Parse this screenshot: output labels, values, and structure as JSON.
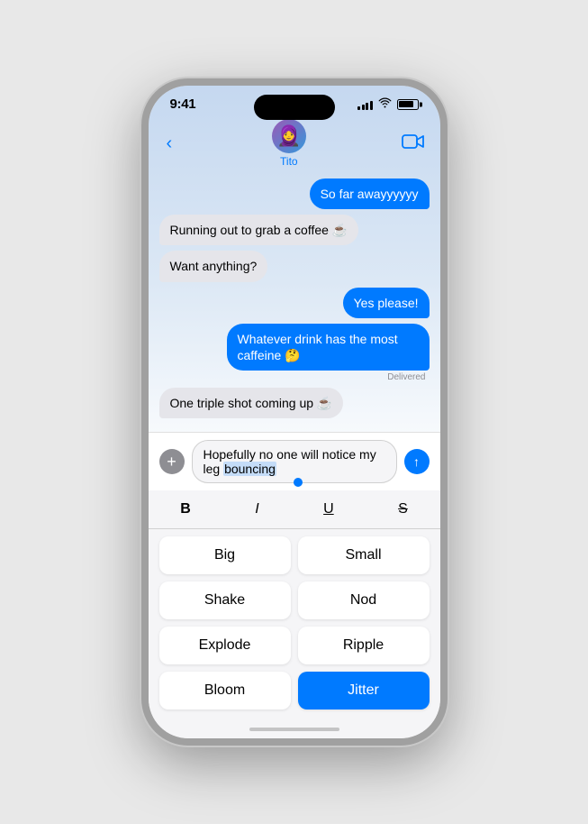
{
  "statusBar": {
    "time": "9:41",
    "signalBars": [
      4,
      6,
      8,
      10,
      12
    ],
    "battery": 85
  },
  "navBar": {
    "backLabel": "‹",
    "contactName": "Tito",
    "avatarEmoji": "🧑‍🦲",
    "videoIcon": "📹"
  },
  "messages": [
    {
      "id": 1,
      "type": "outgoing",
      "text": "So far awayyyyyy",
      "delivered": false
    },
    {
      "id": 2,
      "type": "incoming",
      "text": "Running out to grab a coffee ☕",
      "delivered": false
    },
    {
      "id": 3,
      "type": "incoming",
      "text": "Want anything?",
      "delivered": false
    },
    {
      "id": 4,
      "type": "outgoing",
      "text": "Yes please!",
      "delivered": false
    },
    {
      "id": 5,
      "type": "outgoing",
      "text": "Whatever drink has the most caffeine 🤔",
      "delivered": true
    },
    {
      "id": 6,
      "type": "incoming",
      "text": "One triple shot coming up ☕",
      "delivered": false
    }
  ],
  "deliveredLabel": "Delivered",
  "inputBox": {
    "text": "Hopefully no one will notice my leg ",
    "highlighted": "bouncing",
    "plusIcon": "+",
    "sendIcon": "↑"
  },
  "formatBar": {
    "bold": "B",
    "italic": "I",
    "underline": "U",
    "strikethrough": "S"
  },
  "effects": [
    {
      "id": "big",
      "label": "Big",
      "active": false
    },
    {
      "id": "small",
      "label": "Small",
      "active": false
    },
    {
      "id": "shake",
      "label": "Shake",
      "active": false
    },
    {
      "id": "nod",
      "label": "Nod",
      "active": false
    },
    {
      "id": "explode",
      "label": "Explode",
      "active": false
    },
    {
      "id": "ripple",
      "label": "Ripple",
      "active": false
    },
    {
      "id": "bloom",
      "label": "Bloom",
      "active": false
    },
    {
      "id": "jitter",
      "label": "Jitter",
      "active": true
    }
  ]
}
